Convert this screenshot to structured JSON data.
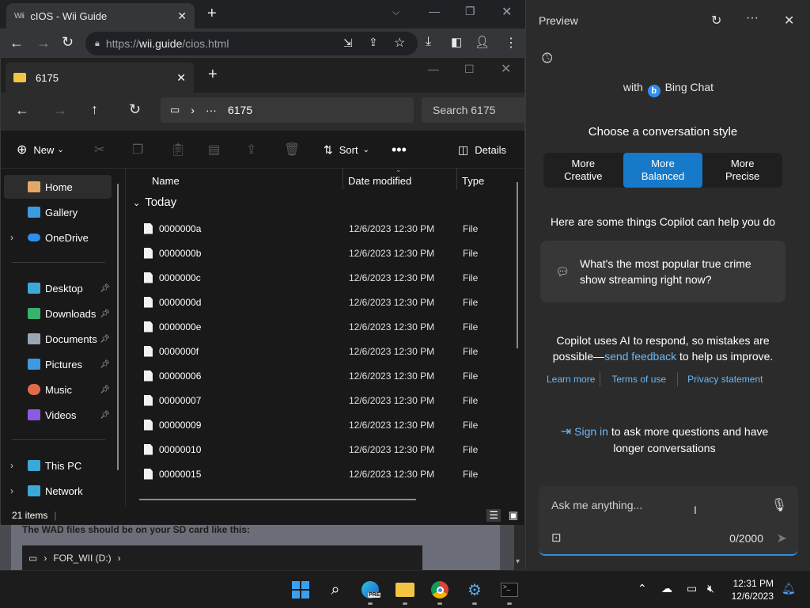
{
  "browser": {
    "tab_title": "cIOS - Wii Guide",
    "tab_favicon": "Wii",
    "url_prefix": "https://",
    "url_host": "wii.guide",
    "url_path": "/cios.html",
    "new_tab": "+"
  },
  "webpage": {
    "text": "The WAD files should be on your SD card like this:",
    "drive_label": "FOR_WII (D:)"
  },
  "explorer": {
    "tab_title": "6175",
    "new_tab": "+",
    "address_folder": "6175",
    "search_placeholder": "Search 6175",
    "commands": {
      "new": "New",
      "sort": "Sort",
      "details": "Details"
    },
    "sidebar": [
      {
        "label": "Home",
        "icon": "home-icon",
        "color": "#e3a868",
        "selected": true
      },
      {
        "label": "Gallery",
        "icon": "gallery-icon",
        "color": "#3c9be0"
      },
      {
        "label": "OneDrive",
        "icon": "cloud-icon",
        "color": "#2f8ff0",
        "expandable": true
      },
      {
        "label": "Desktop",
        "icon": "desktop-icon",
        "color": "#3ca8d8",
        "pinned": true
      },
      {
        "label": "Downloads",
        "icon": "download-icon",
        "color": "#37b36b",
        "pinned": true
      },
      {
        "label": "Documents",
        "icon": "document-icon",
        "color": "#9aa6b3",
        "pinned": true
      },
      {
        "label": "Pictures",
        "icon": "pictures-icon",
        "color": "#3c9be0",
        "pinned": true
      },
      {
        "label": "Music",
        "icon": "music-icon",
        "color": "#e06a4a",
        "pinned": true
      },
      {
        "label": "Videos",
        "icon": "videos-icon",
        "color": "#8a5be0",
        "pinned": true
      },
      {
        "label": "This PC",
        "icon": "pc-icon",
        "color": "#3ca8d8",
        "expandable": true
      },
      {
        "label": "Network",
        "icon": "network-icon",
        "color": "#3ca8d8",
        "expandable": true
      }
    ],
    "columns": [
      "Name",
      "Date modified",
      "Type"
    ],
    "group": "Today",
    "files": [
      {
        "name": "0000000a",
        "date": "12/6/2023 12:30 PM",
        "type": "File"
      },
      {
        "name": "0000000b",
        "date": "12/6/2023 12:30 PM",
        "type": "File"
      },
      {
        "name": "0000000c",
        "date": "12/6/2023 12:30 PM",
        "type": "File"
      },
      {
        "name": "0000000d",
        "date": "12/6/2023 12:30 PM",
        "type": "File"
      },
      {
        "name": "0000000e",
        "date": "12/6/2023 12:30 PM",
        "type": "File"
      },
      {
        "name": "0000000f",
        "date": "12/6/2023 12:30 PM",
        "type": "File"
      },
      {
        "name": "00000006",
        "date": "12/6/2023 12:30 PM",
        "type": "File"
      },
      {
        "name": "00000007",
        "date": "12/6/2023 12:30 PM",
        "type": "File"
      },
      {
        "name": "00000009",
        "date": "12/6/2023 12:30 PM",
        "type": "File"
      },
      {
        "name": "00000010",
        "date": "12/6/2023 12:30 PM",
        "type": "File"
      },
      {
        "name": "00000015",
        "date": "12/6/2023 12:30 PM",
        "type": "File"
      }
    ],
    "status": "21 items"
  },
  "copilot": {
    "title": "Preview",
    "with_prefix": "with",
    "with_brand": "Bing Chat",
    "brand_glyph": "b",
    "choose": "Choose a conversation style",
    "styles": [
      {
        "line1": "More",
        "line2": "Creative"
      },
      {
        "line1": "More",
        "line2": "Balanced",
        "active": true
      },
      {
        "line1": "More",
        "line2": "Precise"
      }
    ],
    "helper": "Here are some things Copilot can help you do",
    "suggestion": "What's the most popular true crime show streaming right now?",
    "disclaimer_pre": "Copilot uses AI to respond, so mistakes are possible—",
    "disclaimer_link": "send feedback",
    "disclaimer_post": " to help us improve.",
    "links": [
      "Learn more",
      "Terms of use",
      "Privacy statement"
    ],
    "signin_link": "Sign in",
    "signin_text": " to ask more questions and have longer conversations",
    "input_placeholder": "Ask me anything...",
    "char_count": "0/2000",
    "accent": "#1679c9"
  },
  "taskbar": {
    "time": "12:31 PM",
    "date": "12/6/2023",
    "edge_badge": "PRE"
  }
}
